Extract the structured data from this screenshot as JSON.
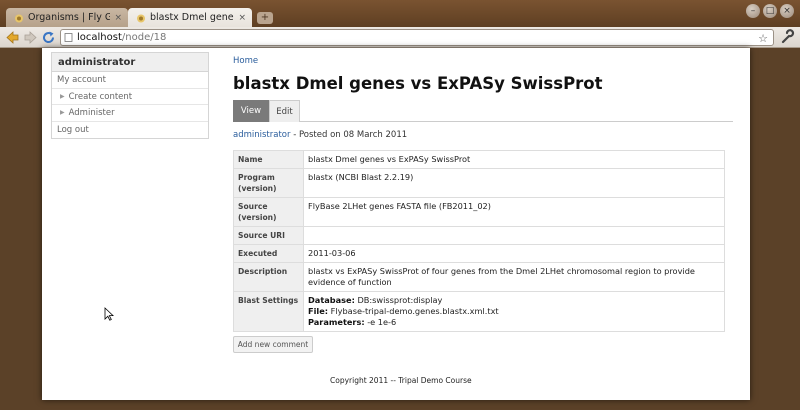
{
  "browser": {
    "tabs": [
      {
        "label": "Organisms | Fly Gene",
        "close": "×",
        "state": "inactive"
      },
      {
        "label": "blastx Dmel genes vs",
        "close": "×",
        "state": "active"
      }
    ],
    "new_tab": "+",
    "window_controls": [
      "–",
      "□",
      "×"
    ],
    "url_host": "localhost",
    "url_path": "/node/18"
  },
  "sidebar": {
    "title": "administrator",
    "items": [
      {
        "label": "My account",
        "arrow": ""
      },
      {
        "label": "Create content",
        "arrow": "▶"
      },
      {
        "label": "Administer",
        "arrow": "▶"
      },
      {
        "label": "Log out",
        "arrow": ""
      }
    ]
  },
  "main": {
    "breadcrumb": "Home",
    "title": "blastx Dmel genes vs ExPASy SwissProt",
    "tabs": [
      "View",
      "Edit"
    ],
    "meta_author": "administrator",
    "meta_posted": " - Posted on 08 March 2011",
    "rows": [
      {
        "label": "Name",
        "value": "blastx Dmel genes vs ExPASy SwissProt"
      },
      {
        "label": "Program (version)",
        "value": "blastx (NCBI Blast 2.2.19)"
      },
      {
        "label": "Source (version)",
        "value": "FlyBase 2LHet genes FASTA file (FB2011_02)"
      },
      {
        "label": "Source URI",
        "value": ""
      },
      {
        "label": "Executed",
        "value": "2011-03-06"
      },
      {
        "label": "Description",
        "value": "blastx vs ExPASy SwissProt of four genes from the Dmel 2LHet chromosomal region to provide evidence of function"
      },
      {
        "label": "Blast Settings",
        "value": ""
      }
    ],
    "blast_settings": {
      "database_label": "Database:",
      "database_value": " DB:swissprot:display",
      "file_label": "File:",
      "file_value": " Flybase-tripal-demo.genes.blastx.xml.txt",
      "params_label": "Parameters:",
      "params_value": " -e 1e-6"
    },
    "comment_button": "Add new comment",
    "footer": "Copyright 2011 -- Tripal Demo Course"
  },
  "colors": {
    "link": "#2a5d9c",
    "active_tab": "#7a7a7a",
    "chrome_frame": "#6b4a2a"
  }
}
